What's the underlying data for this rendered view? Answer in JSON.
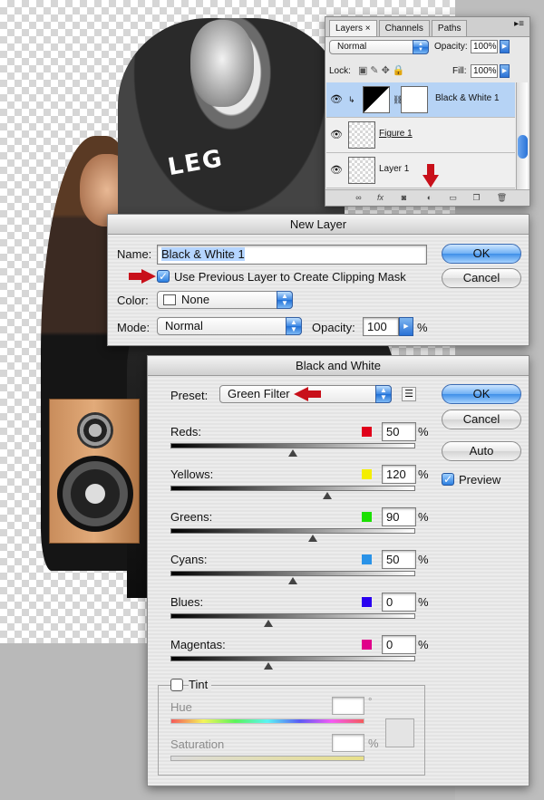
{
  "layers_panel": {
    "tabs": [
      "Layers",
      "Channels",
      "Paths"
    ],
    "close_glyph": "×",
    "blend_mode": "Normal",
    "opacity_label": "Opacity:",
    "opacity_value": "100%",
    "lock_label": "Lock:",
    "fill_label": "Fill:",
    "fill_value": "100%",
    "layers": [
      {
        "name": "Black & White 1",
        "selected": true
      },
      {
        "name": "Figure 1",
        "selected": false
      },
      {
        "name": "Layer 1",
        "selected": false
      }
    ],
    "footer_icons": [
      "link-icon",
      "fx-icon",
      "mask-icon",
      "adjustment-layer-icon",
      "group-folder-icon",
      "new-layer-icon",
      "trash-icon"
    ]
  },
  "new_layer": {
    "title": "New Layer",
    "name_label": "Name:",
    "name_value": "Black & White 1",
    "clip_checkbox_label": "Use Previous Layer to Create Clipping Mask",
    "clip_checked": true,
    "color_label": "Color:",
    "color_value": "None",
    "mode_label": "Mode:",
    "mode_value": "Normal",
    "opacity_label": "Opacity:",
    "opacity_value": "100",
    "percent": "%",
    "ok": "OK",
    "cancel": "Cancel"
  },
  "black_white": {
    "title": "Black and White",
    "preset_label": "Preset:",
    "preset_value": "Green Filter",
    "ok": "OK",
    "cancel": "Cancel",
    "auto": "Auto",
    "preview_label": "Preview",
    "preview_checked": true,
    "percent": "%",
    "channels": [
      {
        "label": "Reds:",
        "value": 50,
        "color": "#e0001a"
      },
      {
        "label": "Yellows:",
        "value": 120,
        "color": "#f4ee00"
      },
      {
        "label": "Greens:",
        "value": 90,
        "color": "#1be000"
      },
      {
        "label": "Cyans:",
        "value": 50,
        "color": "#2a93e8"
      },
      {
        "label": "Blues:",
        "value": 0,
        "color": "#2a00f0"
      },
      {
        "label": "Magentas:",
        "value": 0,
        "color": "#e0008a"
      }
    ],
    "tint_label": "Tint",
    "tint_checked": false,
    "hue_label": "Hue",
    "hue_unit": "°",
    "saturation_label": "Saturation",
    "saturation_unit": "%"
  },
  "artwork": {
    "logo_text": "LEG"
  }
}
